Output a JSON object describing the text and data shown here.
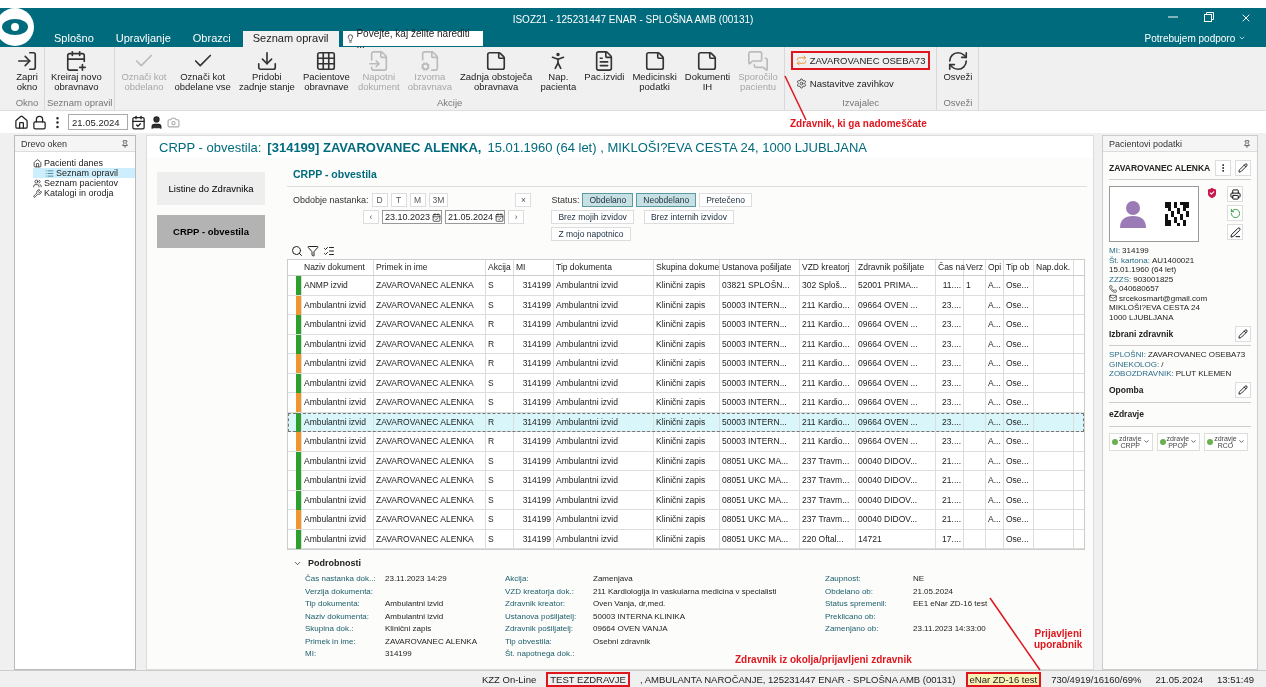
{
  "window": {
    "title": "ISOZ21 - 125231447 ENAR - SPLOŠNA AMB (00131)",
    "support": "Potrebujem podporo"
  },
  "tabs": [
    {
      "label": "Splošno",
      "selected": false
    },
    {
      "label": "Upravljanje",
      "selected": false
    },
    {
      "label": "Obrazci",
      "selected": false
    },
    {
      "label": "Seznam opravil",
      "selected": true
    }
  ],
  "search": {
    "placeholder": "Povejte, kaj želite narediti ..."
  },
  "ribbon": [
    {
      "name": "Okno",
      "items": [
        {
          "kind": "large",
          "label": "Zapri\nokno",
          "disabled": false
        }
      ]
    },
    {
      "name": "Seznam opravil",
      "items": [
        {
          "kind": "large",
          "label": "Kreiraj novo\nobravnavo",
          "disabled": false
        }
      ]
    },
    {
      "name": "Akcije",
      "items": [
        {
          "kind": "large",
          "label": "Označi kot\nobdelano",
          "disabled": true
        },
        {
          "kind": "large",
          "label": "Označi kot\nobdelane vse",
          "disabled": false
        },
        {
          "kind": "large",
          "label": "Pridobi\nzadnje stanje",
          "disabled": false
        },
        {
          "kind": "large",
          "label": "Pacientove\nobravnave",
          "disabled": false
        },
        {
          "kind": "large",
          "label": "Napotni\ndokument",
          "disabled": true
        },
        {
          "kind": "large",
          "label": "Izvorna\nobravnava",
          "disabled": true
        },
        {
          "kind": "large",
          "label": "Zadnja obstoječa\nobravnava",
          "disabled": false
        },
        {
          "kind": "large",
          "label": "Nap.\npacienta",
          "disabled": false
        },
        {
          "kind": "large",
          "label": "Pac.izvidi",
          "disabled": false
        },
        {
          "kind": "large",
          "label": "Medicinski\npodatki",
          "disabled": false
        },
        {
          "kind": "large",
          "label": "Dokumenti\nIH",
          "disabled": false
        },
        {
          "kind": "large",
          "label": "Sporočilo\npacientu",
          "disabled": true
        }
      ]
    },
    {
      "name": "Izvajalec",
      "items": [
        {
          "kind": "small",
          "label": "ZAVAROVANEC OSEBA73",
          "disabled": false,
          "highlighted": true
        },
        {
          "kind": "small",
          "label": "Nastavitve zavihkov",
          "disabled": false,
          "highlighted": false
        }
      ]
    },
    {
      "name": "Osveži",
      "items": [
        {
          "kind": "large",
          "label": "Osveži",
          "disabled": false
        }
      ]
    }
  ],
  "toolbar": {
    "date": "21.05.2024"
  },
  "tree": {
    "title": "Drevo oken",
    "items": [
      {
        "label": "Pacienti danes",
        "selected": false,
        "children": [
          {
            "label": "Seznam opravil",
            "selected": true
          }
        ]
      },
      {
        "label": "Seznam pacientov",
        "selected": false
      },
      {
        "label": "Katalogi in orodja",
        "selected": false
      }
    ]
  },
  "header": {
    "prefix": "CRPP - obvestila:",
    "patient": "[314199] ZAVAROVANEC ALENKA,",
    "details": "15.01.1960 (64 let) , MIKLOŠI?EVA CESTA 24, 1000  LJUBLJANA"
  },
  "nav": [
    {
      "label": "Listine do Zdravnika",
      "selected": false
    },
    {
      "label": "CRPP - obvestila",
      "selected": true
    }
  ],
  "filter": {
    "title": "CRPP - obvestila",
    "period_label": "Obdobje nastanka:",
    "periods": [
      "D",
      "T",
      "M",
      "3M"
    ],
    "clear": "×",
    "prev": "‹",
    "next": "›",
    "date_from": "23.10.2023",
    "date_to": "21.05.2024",
    "status_label": "Status:",
    "statuses": [
      {
        "label": "Obdelano",
        "selected": true
      },
      {
        "label": "Neobdelano",
        "selected": true
      },
      {
        "label": "Pretečeno",
        "selected": false
      }
    ],
    "options": [
      {
        "label": "Brez mojih izvidov",
        "selected": false
      },
      {
        "label": "Brez internih izvidov",
        "selected": false
      },
      {
        "label": "Z mojo napotnico",
        "selected": false
      }
    ]
  },
  "table": {
    "columns": [
      "Naziv dokument",
      "Primek in ime",
      "Akcija",
      "MI",
      "Tip dokumenta",
      "Skupina dokume",
      "Ustanova pošiljate",
      "VZD kreatorj",
      "Zdravnik pošiljate",
      "Čas na",
      "Verz",
      "Opi",
      "Tip ob",
      "Nap.dok."
    ],
    "rows": [
      {
        "color": "#2ca02c",
        "selected": false,
        "cells": [
          "ANMP izvid",
          "ZAVAROVANEC ALENKA",
          "S",
          "314199",
          "Ambulantni izvid",
          "Klinični zapis",
          "03821 SPLOŠN...",
          "302 Sploš...",
          "52001 PRIMA...",
          "11....",
          "1",
          "A...",
          "Ose..."
        ]
      },
      {
        "color": "#f0962e",
        "selected": false,
        "cells": [
          "Ambulantni izvid",
          "ZAVAROVANEC ALENKA",
          "S",
          "314199",
          "Ambulantni izvid",
          "Klinični zapis",
          "50003 INTERN...",
          "211 Kardio...",
          "09664 OVEN ...",
          "23....",
          "",
          "A...",
          "Ose..."
        ]
      },
      {
        "color": "#2ca02c",
        "selected": false,
        "cells": [
          "Ambulantni izvid",
          "ZAVAROVANEC ALENKA",
          "R",
          "314199",
          "Ambulantni izvid",
          "Klinični zapis",
          "50003 INTERN...",
          "211 Kardio...",
          "09664 OVEN ...",
          "23....",
          "",
          "A...",
          "Ose..."
        ]
      },
      {
        "color": "#2ca02c",
        "selected": false,
        "cells": [
          "Ambulantni izvid",
          "ZAVAROVANEC ALENKA",
          "R",
          "314199",
          "Ambulantni izvid",
          "Klinični zapis",
          "50003 INTERN...",
          "211 Kardio...",
          "09664 OVEN ...",
          "23....",
          "",
          "A...",
          "Ose..."
        ]
      },
      {
        "color": "#f0962e",
        "selected": false,
        "cells": [
          "Ambulantni izvid",
          "ZAVAROVANEC ALENKA",
          "R",
          "314199",
          "Ambulantni izvid",
          "Klinični zapis",
          "50003 INTERN...",
          "211 Kardio...",
          "09664 OVEN ...",
          "23....",
          "",
          "A...",
          "Ose..."
        ]
      },
      {
        "color": "#2ca02c",
        "selected": false,
        "cells": [
          "Ambulantni izvid",
          "ZAVAROVANEC ALENKA",
          "S",
          "314199",
          "Ambulantni izvid",
          "Klinični zapis",
          "50003 INTERN...",
          "211 Kardio...",
          "09664 OVEN ...",
          "23....",
          "",
          "A...",
          "Ose..."
        ]
      },
      {
        "color": "#f0962e",
        "selected": false,
        "cells": [
          "Ambulantni izvid",
          "ZAVAROVANEC ALENKA",
          "S",
          "314199",
          "Ambulantni izvid",
          "Klinični zapis",
          "50003 INTERN...",
          "211 Kardio...",
          "09664 OVEN ...",
          "23....",
          "",
          "A...",
          "Ose..."
        ]
      },
      {
        "color": "#2ca02c",
        "selected": true,
        "cells": [
          "Ambulantni izvid",
          "ZAVAROVANEC ALENKA",
          "R",
          "314199",
          "Ambulantni izvid",
          "Klinični zapis",
          "50003 INTERN...",
          "211 Kardio...",
          "09664 OVEN ...",
          "23....",
          "",
          "A...",
          "Ose..."
        ]
      },
      {
        "color": "#f0962e",
        "selected": false,
        "cells": [
          "Ambulantni izvid",
          "ZAVAROVANEC ALENKA",
          "R",
          "314199",
          "Ambulantni izvid",
          "Klinični zapis",
          "50003 INTERN...",
          "211 Kardio...",
          "09664 OVEN ...",
          "23....",
          "",
          "A...",
          "Ose..."
        ]
      },
      {
        "color": "#2ca02c",
        "selected": false,
        "cells": [
          "Ambulantni izvid",
          "ZAVAROVANEC ALENKA",
          "S",
          "314199",
          "Ambulantni izvid",
          "Klinični zapis",
          "08051 UKC MA...",
          "237 Travm...",
          "00040 DIDOV...",
          "21....",
          "",
          "A...",
          "Ose..."
        ]
      },
      {
        "color": "#2ca02c",
        "selected": false,
        "cells": [
          "Ambulantni izvid",
          "ZAVAROVANEC ALENKA",
          "S",
          "314199",
          "Ambulantni izvid",
          "Klinični zapis",
          "08051 UKC MA...",
          "237 Travm...",
          "00040 DIDOV...",
          "21....",
          "",
          "A...",
          "Ose..."
        ]
      },
      {
        "color": "#2ca02c",
        "selected": false,
        "cells": [
          "Ambulantni izvid",
          "ZAVAROVANEC ALENKA",
          "S",
          "314199",
          "Ambulantni izvid",
          "Klinični zapis",
          "08051 UKC MA...",
          "237 Travm...",
          "00040 DIDOV...",
          "21....",
          "",
          "A...",
          "Ose..."
        ]
      },
      {
        "color": "#f0962e",
        "selected": false,
        "cells": [
          "Ambulantni izvid",
          "ZAVAROVANEC ALENKA",
          "S",
          "314199",
          "Ambulantni izvid",
          "Klinični zapis",
          "08051 UKC MA...",
          "237 Travm...",
          "00040 DIDOV...",
          "21....",
          "",
          "A...",
          "Ose..."
        ]
      },
      {
        "color": "#2ca02c",
        "selected": false,
        "cells": [
          "Ambulantni izvid",
          "ZAVAROVANEC ALENKA",
          "S",
          "314199",
          "Ambulantni izvid",
          "Klinični zapis",
          "08051 UKC MA...",
          "220 Oftal...",
          "14721",
          "17....",
          "",
          "",
          "Ose..."
        ]
      }
    ]
  },
  "details": {
    "title": "Podrobnosti",
    "expanded": true,
    "columns": [
      [
        {
          "label": "Čas nastanka dok..:",
          "value": "23.11.2023 14:29"
        },
        {
          "label": "Verzija dokumenta:"
        },
        {
          "label": "Tip dokumenta:",
          "value": "Ambulantni izvid"
        },
        {
          "label": "Naziv dokumenta:",
          "value": "Ambulantni izvid"
        },
        {
          "label": "Skupina dok.:",
          "value": "Klinični zapis"
        },
        {
          "label": "Primek in ime:",
          "value": "ZAVAROVANEC ALENKA"
        },
        {
          "label": "MI:",
          "value": "314199"
        }
      ],
      [
        {
          "label": "Akcija:",
          "value": "Zamenjava"
        },
        {
          "label": "VZD kreatorja dok.:",
          "value": "211 Kardiologija in vaskularna medicina v specialisti"
        },
        {
          "label": "Zdravnik kreator:",
          "value": "Oven Vanja, dr,med."
        },
        {
          "label": "Ustanova pošiljatelj:",
          "value": "50003 INTERNA KLINIKA"
        },
        {
          "label": "Zdravnik pošiljatelj:",
          "value": "09664 OVEN VANJA"
        },
        {
          "label": "Tip obvestila:",
          "value": "Osebni zdravnik"
        },
        {
          "label": "Št. napotnega dok.:"
        }
      ],
      [
        {
          "label": "Zaupnost:",
          "value": "NE"
        },
        {
          "label": "Obdelano ob:",
          "value": "21.05.2024"
        },
        {
          "label": "Status spremenil:",
          "value": "EE1 eNar ZD-16 test"
        },
        {
          "label": "Preklicano ob:"
        },
        {
          "label": "Zamenjano ob:",
          "value": "23.11.2023 14:33:00"
        }
      ]
    ]
  },
  "patient_panel": {
    "title": "Pacientovi podatki",
    "name": "ZAVAROVANEC ALENKA",
    "info": [
      {
        "kind": "labeled",
        "label": "MI:",
        "value": "314199"
      },
      {
        "kind": "labeled",
        "label": "Št. kartona:",
        "value": "AU1400021"
      },
      {
        "kind": "text",
        "value": "15.01.1960 (64 let)"
      },
      {
        "kind": "labeled",
        "label": "ZZZS:",
        "value": "903001825"
      },
      {
        "kind": "phone",
        "value": "040680657"
      },
      {
        "kind": "email",
        "value": "srcekosmart@gmail.com"
      },
      {
        "kind": "text",
        "value": "MIKLOŠI?EVA CESTA 24"
      },
      {
        "kind": "text",
        "value": "1000 LJUBLJANA"
      }
    ],
    "doctors_title": "Izbrani zdravnik",
    "doctors": [
      {
        "label": "SPLOŠNI:",
        "value": "ZAVAROVANEC OSEBA73"
      },
      {
        "label": "GINEKOLOG:",
        "value": "/"
      },
      {
        "label": "ZOBOZDRAVNIK:",
        "value": "PLUT KLEMEN"
      }
    ],
    "note_title": "Opomba",
    "ezdravje_title": "eZdravje",
    "ezdravje": [
      {
        "logo": "zdravje",
        "label": "CRPP"
      },
      {
        "logo": "zdravje",
        "label": "PPOP"
      },
      {
        "logo": "zdravje",
        "label": "RCO"
      }
    ]
  },
  "status_bar": {
    "items": [
      {
        "text": "KZZ On-Line",
        "highlighted": false
      },
      {
        "text": "TEST EZDRAVJE",
        "highlighted": true
      },
      {
        "text": ", AMBULANTA NAROČANJE, 125231447 ENAR - SPLOŠNA AMB (00131)",
        "highlighted": false
      },
      {
        "text": "eNar ZD-16 test",
        "highlighted": true
      },
      {
        "text": "730/4919/16160/69%",
        "highlighted": false
      },
      {
        "text": "21.05.2024",
        "highlighted": false
      },
      {
        "text": "13:51:49",
        "highlighted": false
      }
    ]
  },
  "annotations": [
    "Zdravnik, ki ga nadomeščate",
    "Prijavljeni\nuporabnik",
    "Zdravnik iz okolja/prijavljeni zdravnik"
  ]
}
